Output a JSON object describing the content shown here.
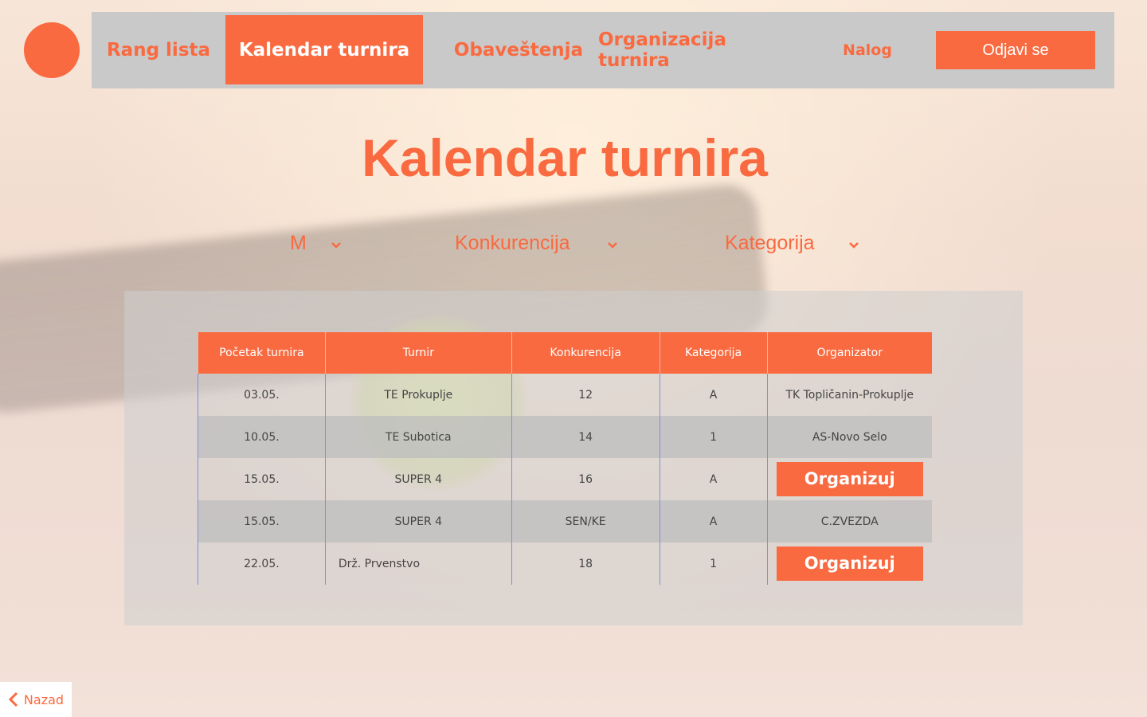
{
  "nav": {
    "items": [
      {
        "label": "Rang lista",
        "active": false
      },
      {
        "label": "Kalendar turnira",
        "active": true
      },
      {
        "label": "Obaveštenja",
        "active": false
      },
      {
        "label": "Organizacija turnira",
        "active": false
      },
      {
        "label": "Nalog",
        "active": false
      }
    ],
    "logout_label": "Odjavi se"
  },
  "page": {
    "title": "Kalendar turnira"
  },
  "filters": [
    {
      "selected": "M",
      "icon": "chevron-down-icon"
    },
    {
      "selected": "Konkurencija",
      "icon": "chevron-down-icon"
    },
    {
      "selected": "Kategorija",
      "icon": "chevron-down-icon"
    }
  ],
  "table": {
    "headers": [
      "Početak turnira",
      "Turnir",
      "Konkurencija",
      "Kategorija",
      "Organizator"
    ],
    "rows": [
      {
        "start": "03.05.",
        "tournament": "TE Prokuplje",
        "competition": "12",
        "category": "A",
        "organizer": "TK Topličanin-Prokuplje"
      },
      {
        "start": "10.05.",
        "tournament": "TE Subotica",
        "competition": "14",
        "category": "1",
        "organizer": "AS-Novo Selo"
      },
      {
        "start": "15.05.",
        "tournament": "SUPER 4",
        "competition": "16",
        "category": "A",
        "organizer": "Organizuj"
      },
      {
        "start": "15.05.",
        "tournament": "SUPER 4",
        "competition": "SEN/KE",
        "category": "A",
        "organizer": "C.ZVEZDA"
      },
      {
        "start": "22.05.",
        "tournament": "Drž. Prvenstvo",
        "competition": "18",
        "category": "1",
        "organizer": "Organizuj"
      }
    ]
  },
  "back": {
    "label": "Nazad",
    "icon": "chevron-left-icon"
  },
  "colors": {
    "accent": "#f96a40",
    "nav_bg": "#c9c9c9"
  }
}
